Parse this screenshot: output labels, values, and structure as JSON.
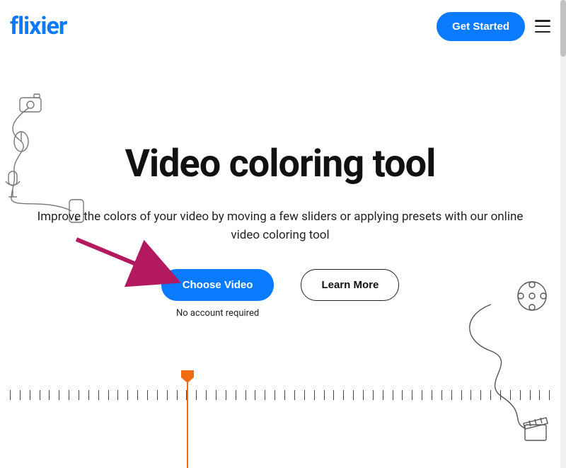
{
  "header": {
    "logo_text": "flixier",
    "get_started_label": "Get Started"
  },
  "hero": {
    "title": "Video coloring tool",
    "subtitle": "Improve the colors of your video by moving a few sliders or applying presets with our online video coloring tool"
  },
  "cta": {
    "choose_video_label": "Choose Video",
    "no_account_label": "No account required",
    "learn_more_label": "Learn More"
  },
  "colors": {
    "primary": "#0a7aff",
    "playhead": "#f26a12",
    "arrow": "#b3195e"
  }
}
